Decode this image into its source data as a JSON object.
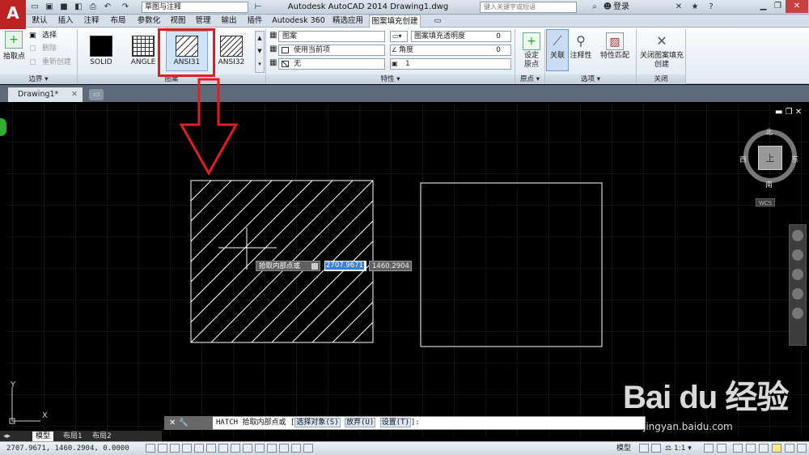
{
  "app": {
    "title": "Autodesk AutoCAD 2014    Drawing1.dwg",
    "workspace": "草图与注释",
    "search_placeholder": "键入关键字或短语",
    "login_label": "登录"
  },
  "tabs": [
    "默认",
    "插入",
    "注释",
    "布局",
    "参数化",
    "视图",
    "管理",
    "输出",
    "插件",
    "Autodesk 360",
    "精选应用",
    "图案填充创建"
  ],
  "ribbon": {
    "boundary": {
      "pick_point": "拾取点",
      "select": "选择",
      "remove": "删除",
      "recreate": "重新创建",
      "panel_label": "边界"
    },
    "pattern": {
      "items": [
        "SOLID",
        "ANGLE",
        "ANSI31",
        "ANSI32"
      ],
      "selected": "ANSI31",
      "panel_label": "图案"
    },
    "properties": {
      "type": "图案",
      "color": "使用当前项",
      "bg_color": "无",
      "transparency_label": "图案填充透明度",
      "transparency_value": "0",
      "angle_label": "角度",
      "angle_value": "0",
      "scale_value": "1",
      "panel_label": "特性"
    },
    "origin": {
      "set_origin": "设定原点",
      "panel_label": "原点"
    },
    "options": {
      "associative": "关联",
      "annotative": "注释性",
      "match": "特性匹配",
      "panel_label": "选项"
    },
    "close": {
      "close_label": "关闭图案填充创建",
      "panel_label": "关闭"
    }
  },
  "document_tab": "Drawing1*",
  "viewcube": {
    "north": "北",
    "south": "南",
    "east": "东",
    "west": "西",
    "face": "上",
    "wcs": "WCS"
  },
  "dynamic_input": {
    "prompt": "拾取内部点或",
    "x": "2707.9671",
    "y": "1460.2904"
  },
  "command_line": {
    "head": "✕ 🔧",
    "text": "HATCH 拾取内部点或 [",
    "opt1": "选择对象(S)",
    "opt2": "放弃(U)",
    "opt3": "设置(T)",
    "tail": "]:"
  },
  "layout_tabs": [
    "模型",
    "布局1",
    "布局2"
  ],
  "status": {
    "coords": "2707.9671, 1460.2904, 0.0000",
    "model": "模型",
    "scale": "1:1"
  },
  "watermark": {
    "brand": "Bai du 经验",
    "url": "jingyan.baidu.com"
  },
  "ucs": {
    "x": "X",
    "y": "Y"
  },
  "colors": {
    "accent": "#e02020",
    "selection": "#3a7fe0"
  }
}
